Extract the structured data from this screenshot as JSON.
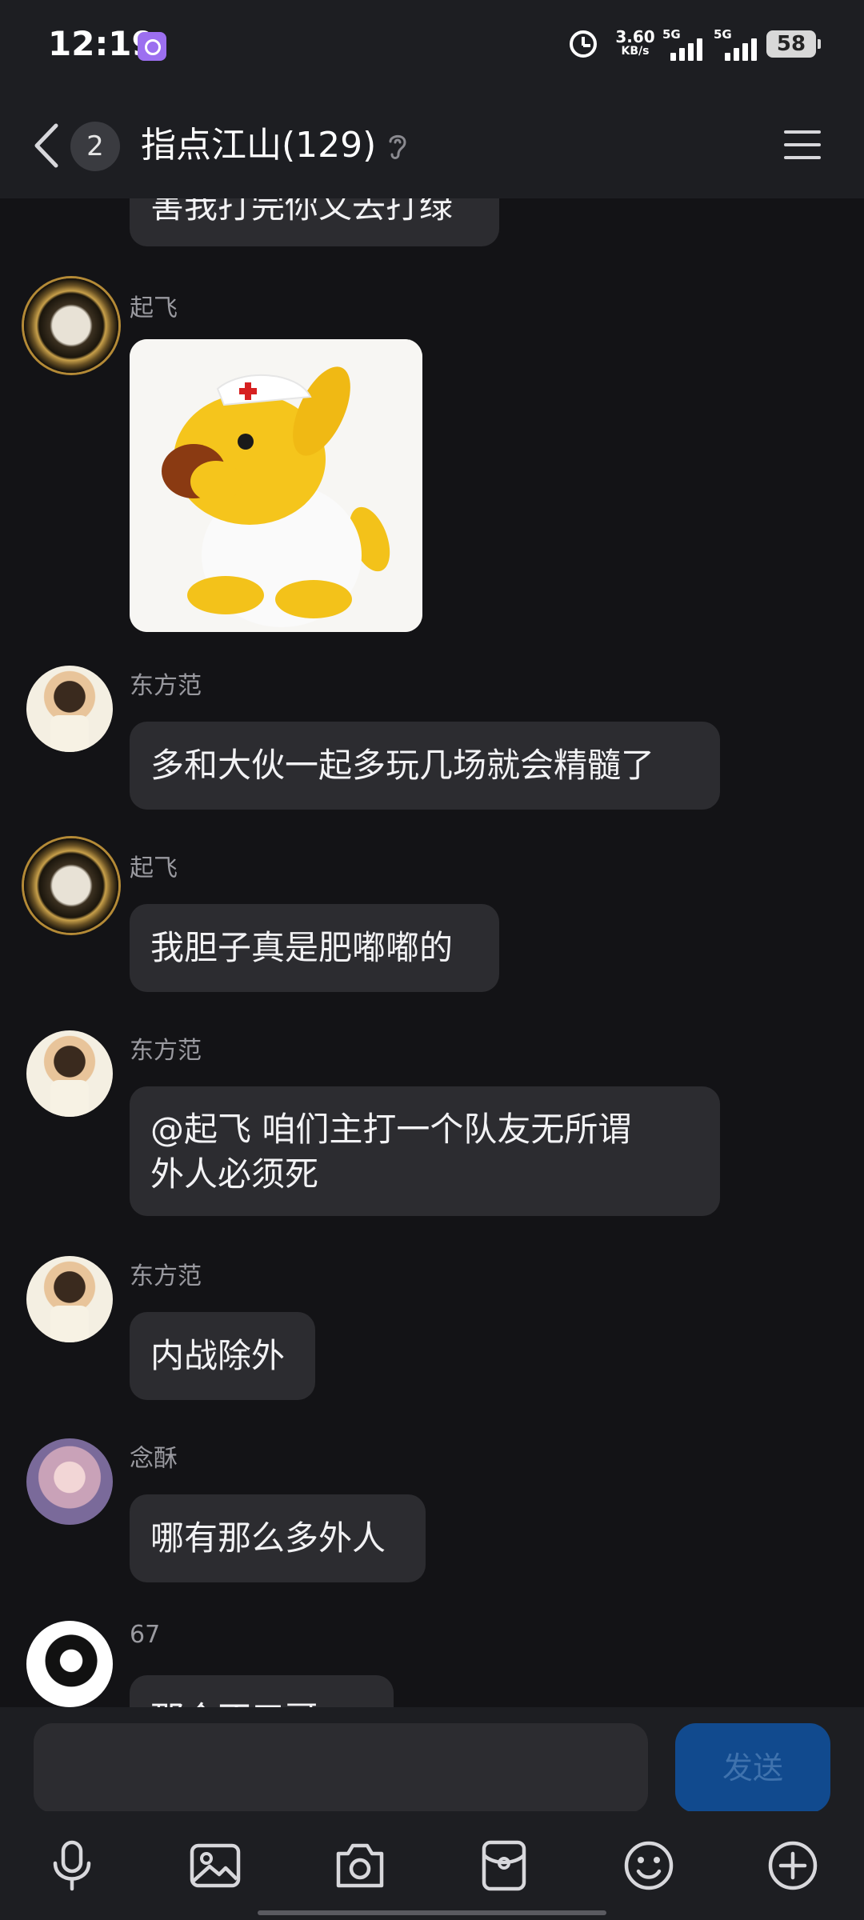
{
  "status_bar": {
    "time": "12:19",
    "net_speed": "3.60",
    "net_unit": "KB/s",
    "sim1": "5G",
    "sim2": "5G",
    "battery": "58"
  },
  "header": {
    "unread_count": "2",
    "title": "指点江山(129)"
  },
  "messages": [
    {
      "sender": "",
      "text": "害我打完你又去打绿",
      "avatar": "none"
    },
    {
      "sender": "起飞",
      "text": "",
      "avatar": "gold-ring-avatar",
      "sticker": "yellow-dog-nurse-sticker"
    },
    {
      "sender": "东方范",
      "text": "多和大伙一起多玩几场就会精髓了",
      "avatar": "boy-avatar"
    },
    {
      "sender": "起飞",
      "text": "我胆子真是肥嘟嘟的",
      "avatar": "gold-ring-avatar"
    },
    {
      "sender": "东方范",
      "text_line1": "@起飞 咱们主打一个队友无所谓",
      "text_line2": "外人必须死",
      "avatar": "boy-avatar"
    },
    {
      "sender": "东方范",
      "text": "内战除外",
      "avatar": "boy-avatar"
    },
    {
      "sender": "念酥",
      "text": "哪有那么多外人",
      "avatar": "girl-avatar"
    },
    {
      "sender": "67",
      "text": "那个不三哥",
      "avatar": "bw-avatar"
    }
  ],
  "composer": {
    "placeholder": "",
    "send_label": "发送"
  },
  "toolbar": [
    "microphone-icon",
    "image-icon",
    "camera-icon",
    "red-packet-icon",
    "emoji-icon",
    "plus-icon"
  ],
  "colors": {
    "background": "#131316",
    "bar": "#1d1e22",
    "bubble": "#2c2c30",
    "send_button": "#114a8e"
  }
}
